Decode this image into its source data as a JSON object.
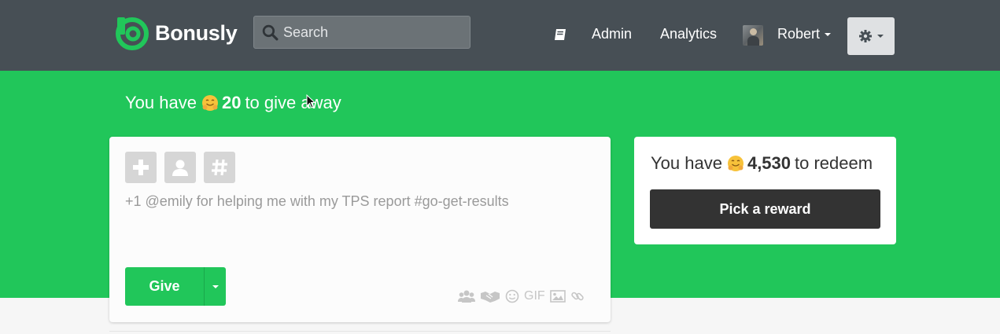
{
  "brand": {
    "name": "Bonusly",
    "color": "#21c65a"
  },
  "search": {
    "placeholder": "Search"
  },
  "nav": {
    "book_icon": "book-icon",
    "admin": "Admin",
    "analytics": "Analytics",
    "user": "Robert",
    "settings_icon": "gear-icon"
  },
  "hero": {
    "give_prefix": "You have",
    "give_amount": "20",
    "give_suffix": "to give away"
  },
  "give_card": {
    "placeholder": "+1 @emily for helping me with my TPS report #go-get-results",
    "give_label": "Give",
    "chips": [
      "plus-icon",
      "user-icon",
      "hashtag-icon"
    ],
    "tools": [
      "group-icon",
      "handshake-icon",
      "smiley-icon",
      "GIF",
      "image-icon",
      "link-icon"
    ]
  },
  "redeem_card": {
    "prefix": "You have",
    "amount": "4,530",
    "suffix": "to redeem",
    "button_label": "Pick a reward"
  },
  "colors": {
    "navbar": "#474f55",
    "hero": "#21c65a",
    "dark_button": "#333333"
  }
}
